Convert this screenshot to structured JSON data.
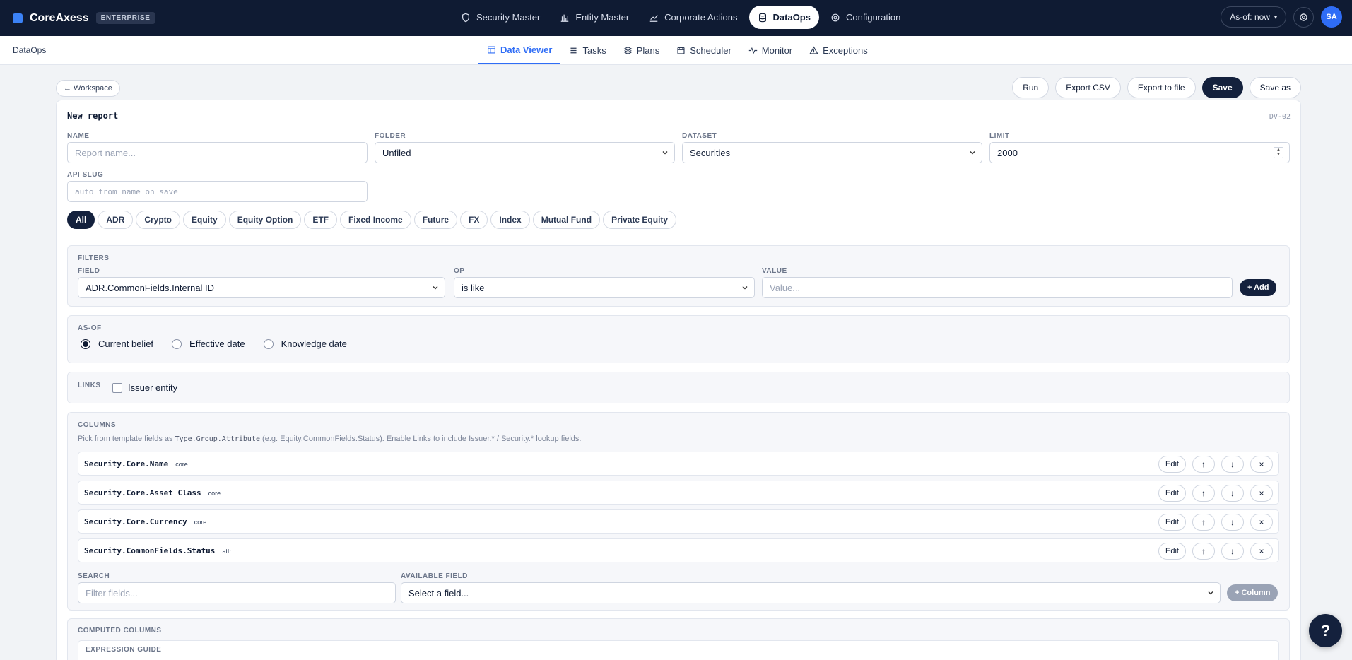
{
  "app": {
    "name": "CoreAxess",
    "badge": "ENTERPRISE"
  },
  "topnav": [
    {
      "label": "Security Master",
      "icon": "shield-icon"
    },
    {
      "label": "Entity Master",
      "icon": "building-icon"
    },
    {
      "label": "Corporate Actions",
      "icon": "trend-icon"
    },
    {
      "label": "DataOps",
      "icon": "database-icon",
      "active": true
    },
    {
      "label": "Configuration",
      "icon": "gear-icon"
    }
  ],
  "header_right": {
    "asof": "As-of: now",
    "avatar": "SA"
  },
  "subbar": {
    "title": "DataOps",
    "tabs": [
      {
        "label": "Data Viewer",
        "icon": "table-icon",
        "active": true
      },
      {
        "label": "Tasks",
        "icon": "list-icon"
      },
      {
        "label": "Plans",
        "icon": "layers-icon"
      },
      {
        "label": "Scheduler",
        "icon": "calendar-icon"
      },
      {
        "label": "Monitor",
        "icon": "pulse-icon"
      },
      {
        "label": "Exceptions",
        "icon": "warning-icon"
      }
    ]
  },
  "toolbar": {
    "back": "← Workspace",
    "run": "Run",
    "export_csv": "Export CSV",
    "export_file": "Export to file",
    "save": "Save",
    "save_as": "Save as"
  },
  "report": {
    "title": "New report",
    "code": "DV-02",
    "name_label": "NAME",
    "name_placeholder": "Report name...",
    "folder_label": "FOLDER",
    "folder_value": "Unfiled",
    "dataset_label": "DATASET",
    "dataset_value": "Securities",
    "limit_label": "LIMIT",
    "limit_value": "2000",
    "slug_label": "API SLUG",
    "slug_placeholder": "auto from name on save"
  },
  "asset_chips": [
    "All",
    "ADR",
    "Crypto",
    "Equity",
    "Equity Option",
    "ETF",
    "Fixed Income",
    "Future",
    "FX",
    "Index",
    "Mutual Fund",
    "Private Equity"
  ],
  "filters": {
    "title": "FILTERS",
    "field_label": "FIELD",
    "field_value": "ADR.CommonFields.Internal ID",
    "op_label": "OP",
    "op_value": "is like",
    "value_label": "VALUE",
    "value_placeholder": "Value...",
    "add": "+ Add"
  },
  "asof": {
    "title": "AS-OF",
    "options": [
      "Current belief",
      "Effective date",
      "Knowledge date"
    ],
    "selected": "Current belief"
  },
  "links": {
    "title": "LINKS",
    "issuer": "Issuer entity"
  },
  "columns": {
    "title": "COLUMNS",
    "help_prefix": "Pick from template fields as ",
    "help_code": "Type.Group.Attribute",
    "help_suffix": " (e.g. Equity.CommonFields.Status). Enable Links to include Issuer.* / Security.* lookup fields.",
    "rows": [
      {
        "name": "Security.Core.Name",
        "tag": "core"
      },
      {
        "name": "Security.Core.Asset Class",
        "tag": "core"
      },
      {
        "name": "Security.Core.Currency",
        "tag": "core"
      },
      {
        "name": "Security.CommonFields.Status",
        "tag": "attr"
      }
    ],
    "edit": "Edit",
    "up": "↑",
    "down": "↓",
    "remove": "×",
    "search_label": "SEARCH",
    "search_placeholder": "Filter fields...",
    "available_label": "AVAILABLE FIELD",
    "available_value": "Select a field...",
    "add_column": "+ Column"
  },
  "computed": {
    "title": "COMPUTED COLUMNS",
    "guide_label": "EXPRESSION GUIDE"
  },
  "help_fab": "?"
}
